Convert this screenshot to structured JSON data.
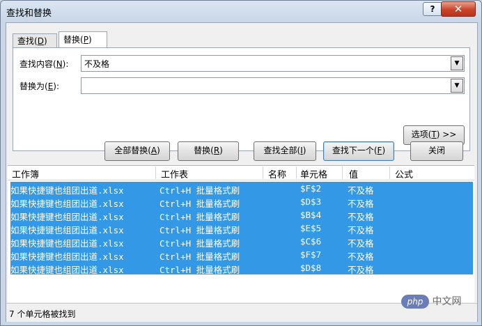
{
  "window": {
    "title": "查找和替换",
    "help_label": "?",
    "close_label": "✕"
  },
  "tabs": [
    {
      "label": "查找(",
      "key": "D",
      "suffix": ")"
    },
    {
      "label": "替换(",
      "key": "P",
      "suffix": ")"
    }
  ],
  "find": {
    "label": "查找内容(",
    "key": "N",
    "suffix": "):",
    "value": "不及格"
  },
  "replace": {
    "label": "替换为(",
    "key": "E",
    "suffix": "):",
    "value": ""
  },
  "options_button": {
    "label": "选项(",
    "key": "T",
    "suffix": ") >>"
  },
  "buttons": {
    "replace_all": {
      "label": "全部替换(",
      "key": "A",
      "suffix": ")"
    },
    "replace": {
      "label": "替换(",
      "key": "R",
      "suffix": ")"
    },
    "find_all": {
      "label": "查找全部(",
      "key": "I",
      "suffix": ")"
    },
    "find_next": {
      "label": "查找下一个(",
      "key": "F",
      "suffix": ")"
    },
    "close": {
      "label": "关闭"
    }
  },
  "results": {
    "columns": [
      "工作簿",
      "工作表",
      "名称",
      "单元格",
      "值",
      "公式"
    ],
    "rows": [
      {
        "workbook": "如果快捷键也组团出道.xlsx",
        "sheet": "Ctrl+H 批量格式刷",
        "name": "",
        "cell": "$F$2",
        "value": "不及格",
        "formula": ""
      },
      {
        "workbook": "如果快捷键也组团出道.xlsx",
        "sheet": "Ctrl+H 批量格式刷",
        "name": "",
        "cell": "$D$3",
        "value": "不及格",
        "formula": ""
      },
      {
        "workbook": "如果快捷键也组团出道.xlsx",
        "sheet": "Ctrl+H 批量格式刷",
        "name": "",
        "cell": "$B$4",
        "value": "不及格",
        "formula": ""
      },
      {
        "workbook": "如果快捷键也组团出道.xlsx",
        "sheet": "Ctrl+H 批量格式刷",
        "name": "",
        "cell": "$E$5",
        "value": "不及格",
        "formula": ""
      },
      {
        "workbook": "如果快捷键也组团出道.xlsx",
        "sheet": "Ctrl+H 批量格式刷",
        "name": "",
        "cell": "$C$6",
        "value": "不及格",
        "formula": ""
      },
      {
        "workbook": "如果快捷键也组团出道.xlsx",
        "sheet": "Ctrl+H 批量格式刷",
        "name": "",
        "cell": "$F$7",
        "value": "不及格",
        "formula": ""
      },
      {
        "workbook": "如果快捷键也组团出道.xlsx",
        "sheet": "Ctrl+H 批量格式刷",
        "name": "",
        "cell": "$D$8",
        "value": "不及格",
        "formula": ""
      }
    ]
  },
  "status": {
    "text": "7 个单元格被找到"
  },
  "watermark": {
    "logo": "php",
    "text": "中文网"
  },
  "colors": {
    "selection": "#3399e6",
    "panel": "#f0f0f0",
    "title_bar": "#c9d6e7"
  }
}
